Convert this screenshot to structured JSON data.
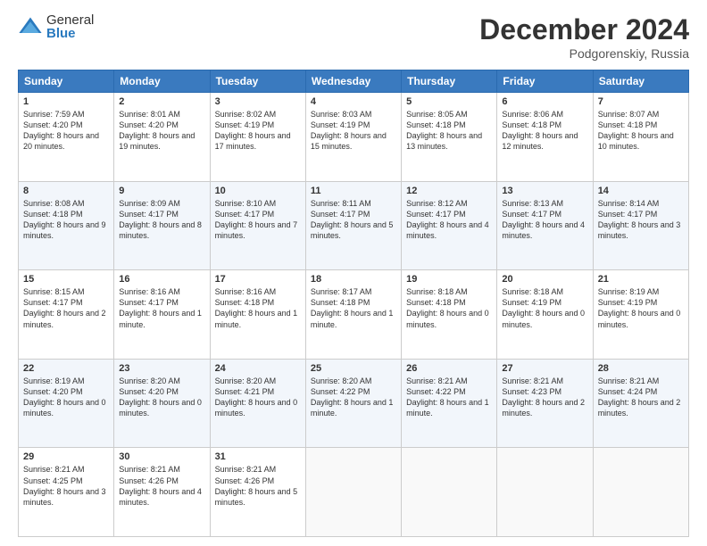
{
  "logo": {
    "general": "General",
    "blue": "Blue"
  },
  "title": "December 2024",
  "location": "Podgorenskiy, Russia",
  "days": [
    "Sunday",
    "Monday",
    "Tuesday",
    "Wednesday",
    "Thursday",
    "Friday",
    "Saturday"
  ],
  "weeks": [
    [
      {
        "day": "1",
        "sunrise": "7:59 AM",
        "sunset": "4:20 PM",
        "daylight": "8 hours and 20 minutes."
      },
      {
        "day": "2",
        "sunrise": "8:01 AM",
        "sunset": "4:20 PM",
        "daylight": "8 hours and 19 minutes."
      },
      {
        "day": "3",
        "sunrise": "8:02 AM",
        "sunset": "4:19 PM",
        "daylight": "8 hours and 17 minutes."
      },
      {
        "day": "4",
        "sunrise": "8:03 AM",
        "sunset": "4:19 PM",
        "daylight": "8 hours and 15 minutes."
      },
      {
        "day": "5",
        "sunrise": "8:05 AM",
        "sunset": "4:18 PM",
        "daylight": "8 hours and 13 minutes."
      },
      {
        "day": "6",
        "sunrise": "8:06 AM",
        "sunset": "4:18 PM",
        "daylight": "8 hours and 12 minutes."
      },
      {
        "day": "7",
        "sunrise": "8:07 AM",
        "sunset": "4:18 PM",
        "daylight": "8 hours and 10 minutes."
      }
    ],
    [
      {
        "day": "8",
        "sunrise": "8:08 AM",
        "sunset": "4:18 PM",
        "daylight": "8 hours and 9 minutes."
      },
      {
        "day": "9",
        "sunrise": "8:09 AM",
        "sunset": "4:17 PM",
        "daylight": "8 hours and 8 minutes."
      },
      {
        "day": "10",
        "sunrise": "8:10 AM",
        "sunset": "4:17 PM",
        "daylight": "8 hours and 7 minutes."
      },
      {
        "day": "11",
        "sunrise": "8:11 AM",
        "sunset": "4:17 PM",
        "daylight": "8 hours and 5 minutes."
      },
      {
        "day": "12",
        "sunrise": "8:12 AM",
        "sunset": "4:17 PM",
        "daylight": "8 hours and 4 minutes."
      },
      {
        "day": "13",
        "sunrise": "8:13 AM",
        "sunset": "4:17 PM",
        "daylight": "8 hours and 4 minutes."
      },
      {
        "day": "14",
        "sunrise": "8:14 AM",
        "sunset": "4:17 PM",
        "daylight": "8 hours and 3 minutes."
      }
    ],
    [
      {
        "day": "15",
        "sunrise": "8:15 AM",
        "sunset": "4:17 PM",
        "daylight": "8 hours and 2 minutes."
      },
      {
        "day": "16",
        "sunrise": "8:16 AM",
        "sunset": "4:17 PM",
        "daylight": "8 hours and 1 minute."
      },
      {
        "day": "17",
        "sunrise": "8:16 AM",
        "sunset": "4:18 PM",
        "daylight": "8 hours and 1 minute."
      },
      {
        "day": "18",
        "sunrise": "8:17 AM",
        "sunset": "4:18 PM",
        "daylight": "8 hours and 1 minute."
      },
      {
        "day": "19",
        "sunrise": "8:18 AM",
        "sunset": "4:18 PM",
        "daylight": "8 hours and 0 minutes."
      },
      {
        "day": "20",
        "sunrise": "8:18 AM",
        "sunset": "4:19 PM",
        "daylight": "8 hours and 0 minutes."
      },
      {
        "day": "21",
        "sunrise": "8:19 AM",
        "sunset": "4:19 PM",
        "daylight": "8 hours and 0 minutes."
      }
    ],
    [
      {
        "day": "22",
        "sunrise": "8:19 AM",
        "sunset": "4:20 PM",
        "daylight": "8 hours and 0 minutes."
      },
      {
        "day": "23",
        "sunrise": "8:20 AM",
        "sunset": "4:20 PM",
        "daylight": "8 hours and 0 minutes."
      },
      {
        "day": "24",
        "sunrise": "8:20 AM",
        "sunset": "4:21 PM",
        "daylight": "8 hours and 0 minutes."
      },
      {
        "day": "25",
        "sunrise": "8:20 AM",
        "sunset": "4:22 PM",
        "daylight": "8 hours and 1 minute."
      },
      {
        "day": "26",
        "sunrise": "8:21 AM",
        "sunset": "4:22 PM",
        "daylight": "8 hours and 1 minute."
      },
      {
        "day": "27",
        "sunrise": "8:21 AM",
        "sunset": "4:23 PM",
        "daylight": "8 hours and 2 minutes."
      },
      {
        "day": "28",
        "sunrise": "8:21 AM",
        "sunset": "4:24 PM",
        "daylight": "8 hours and 2 minutes."
      }
    ],
    [
      {
        "day": "29",
        "sunrise": "8:21 AM",
        "sunset": "4:25 PM",
        "daylight": "8 hours and 3 minutes."
      },
      {
        "day": "30",
        "sunrise": "8:21 AM",
        "sunset": "4:26 PM",
        "daylight": "8 hours and 4 minutes."
      },
      {
        "day": "31",
        "sunrise": "8:21 AM",
        "sunset": "4:26 PM",
        "daylight": "8 hours and 5 minutes."
      },
      null,
      null,
      null,
      null
    ]
  ],
  "labels": {
    "sunrise": "Sunrise:",
    "sunset": "Sunset:",
    "daylight": "Daylight:"
  }
}
